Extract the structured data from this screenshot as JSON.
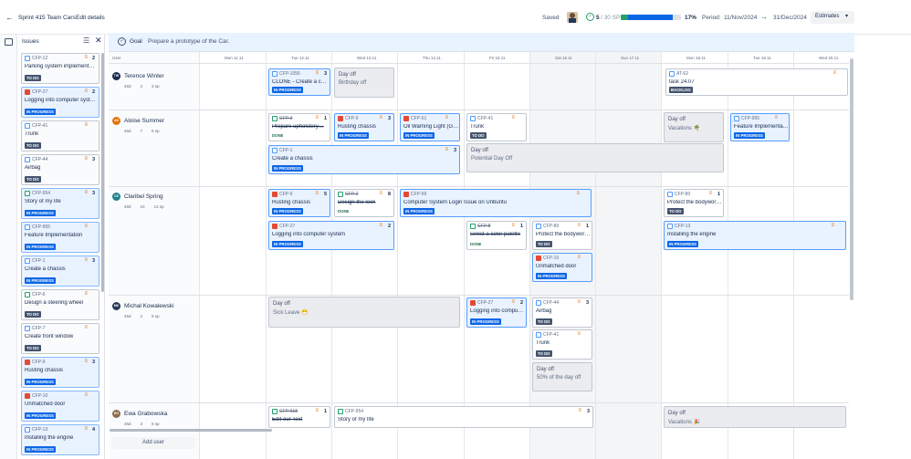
{
  "topbar": {
    "sprint": "Sprint 415 Team Cars",
    "edit": "Edit details",
    "saved": "Saved",
    "done_count": "5",
    "sp_total": "/ 30 SP",
    "progress_pct": "17%",
    "progress_value": 0.17,
    "period_label": "Period:",
    "start": "11/Nov/2024",
    "end": "31/Dec/2024",
    "estimates": "Estimates"
  },
  "goal": {
    "label": "Goal",
    "text": "Prepare a prototype of the Car."
  },
  "sidebar": {
    "title": "Issues",
    "items": [
      {
        "key": "CFP-12",
        "title": "Parking system implement…",
        "status": "TO DO",
        "est": "2",
        "type": "task"
      },
      {
        "key": "CFP-27",
        "title": "Logging into computer syst…",
        "status": "IN PROGRESS",
        "est": "2",
        "type": "bug"
      },
      {
        "key": "CFP-41",
        "title": "Trunk",
        "status": "TO DO",
        "est": "",
        "type": "task"
      },
      {
        "key": "CFP-44",
        "title": "Airbag",
        "status": "TO DO",
        "est": "3",
        "type": "task"
      },
      {
        "key": "CFP-954",
        "title": "Story of my life",
        "status": "IN PROGRESS",
        "est": "3",
        "type": "story"
      },
      {
        "key": "CFP-955",
        "title": "Feature Implementation",
        "status": "IN PROGRESS",
        "est": "",
        "type": "task"
      },
      {
        "key": "CFP-1",
        "title": "Create a chassis",
        "status": "IN PROGRESS",
        "est": "3",
        "type": "task"
      },
      {
        "key": "CFP-6",
        "title": "Design a steering wheel",
        "status": "TO DO",
        "est": "",
        "type": "story"
      },
      {
        "key": "CFP-7",
        "title": "Create front window",
        "status": "TO DO",
        "est": "",
        "type": "task"
      },
      {
        "key": "CFP-9",
        "title": "Rusting chassis",
        "status": "IN PROGRESS",
        "est": "3",
        "type": "bug"
      },
      {
        "key": "CFP-10",
        "title": "Unmatched door",
        "status": "IN PROGRESS",
        "est": "",
        "type": "bug"
      },
      {
        "key": "CFP-13",
        "title": "Installing the engine",
        "status": "IN PROGRESS",
        "est": "4",
        "type": "task"
      }
    ]
  },
  "grid": {
    "user_col": "User",
    "days": [
      "Mon 11.11",
      "Tue 12.11",
      "Wed 13.11",
      "Thu 14.11",
      "Fri 15.11",
      "Sat 16.11",
      "Sun 17.11",
      "Mon 18.11",
      "Tue 19.11",
      "Wed 20.11"
    ],
    "add_user": "Add user"
  },
  "users": [
    {
      "name": "Terence Winter",
      "initials": "TW",
      "color": "#172b4d",
      "hours": "46d",
      "tasks": "3",
      "sp": "3 sp"
    },
    {
      "name": "Aloise Summer",
      "initials": "AS",
      "color": "#e2740b",
      "hours": "46d",
      "tasks": "7",
      "sp": "8 sp"
    },
    {
      "name": "Claribel Spring",
      "initials": "CS",
      "color": "#1d7f8c",
      "hours": "49d",
      "tasks": "10",
      "sp": "13 sp"
    },
    {
      "name": "Michał Kowalewski",
      "initials": "MK",
      "color": "#253858",
      "hours": "45d",
      "tasks": "4",
      "sp": "5 sp"
    },
    {
      "name": "Ewa Grabowska",
      "initials": "EG",
      "color": "#8a6d4b",
      "hours": "45d",
      "tasks": "3",
      "sp": "6 sp"
    }
  ],
  "cards": [
    {
      "key": "CFP-1056",
      "title": "CLONE - Create a c…",
      "status": "IN PROGRESS",
      "est": "3",
      "type": "task",
      "strike": false
    },
    {
      "key": "AT-62",
      "title": "task 24.07",
      "status": "BACKLOG",
      "est": "",
      "type": "task",
      "strike": false
    },
    {
      "key": "CFP-3",
      "title": "Prepare upholstery…",
      "status": "DONE",
      "est": "1",
      "type": "story",
      "strike": true
    },
    {
      "key": "CFP-9",
      "title": "Rusting chassis",
      "status": "IN PROGRESS",
      "est": "3",
      "type": "bug",
      "strike": false
    },
    {
      "key": "CFP-51",
      "title": "Oil Warning Light (G…",
      "status": "IN PROGRESS",
      "est": "",
      "type": "bug",
      "strike": false
    },
    {
      "key": "CFP-41",
      "title": "Trunk",
      "status": "TO DO",
      "est": "",
      "type": "task",
      "strike": false
    },
    {
      "key": "CFP-955",
      "title": "Feature Implementa…",
      "status": "IN PROGRESS",
      "est": "",
      "type": "task",
      "strike": false
    },
    {
      "key": "CFP-1",
      "title": "Create a chassis",
      "status": "IN PROGRESS",
      "est": "3",
      "type": "task",
      "strike": false
    },
    {
      "key": "CFP-9",
      "title": "Rusting chassis",
      "status": "IN PROGRESS",
      "est": "5",
      "type": "bug",
      "strike": false
    },
    {
      "key": "CFP-2",
      "title": "Design the look",
      "status": "DONE",
      "est": "8",
      "type": "story",
      "strike": true
    },
    {
      "key": "CFP-59",
      "title": "Computer System Login Issue on Unbuntu",
      "status": "IN PROGRESS",
      "est": "",
      "type": "bug",
      "strike": false
    },
    {
      "key": "CFP-80",
      "title": "Protect the bodywor…",
      "status": "TO DO",
      "est": "1",
      "type": "task",
      "strike": false
    },
    {
      "key": "CFP-27",
      "title": "Logging into computer system",
      "status": "IN PROGRESS",
      "est": "2",
      "type": "bug",
      "strike": false
    },
    {
      "key": "CFP-8",
      "title": "select a color palette",
      "status": "DONE",
      "est": "1",
      "type": "story",
      "strike": true
    },
    {
      "key": "CFP-80",
      "title": "Protect the bodywor…",
      "status": "TO DO",
      "est": "1",
      "type": "task",
      "strike": false
    },
    {
      "key": "CFP-13",
      "title": "Installing the engine",
      "status": "IN PROGRESS",
      "est": "",
      "type": "task",
      "strike": false
    },
    {
      "key": "CFP-10",
      "title": "Unmatched door",
      "status": "IN PROGRESS",
      "est": "",
      "type": "bug",
      "strike": false
    },
    {
      "key": "CFP-27",
      "title": "Logging into compu…",
      "status": "IN PROGRESS",
      "est": "2",
      "type": "bug",
      "strike": false
    },
    {
      "key": "CFP-44",
      "title": "Airbag",
      "status": "TO DO",
      "est": "3",
      "type": "task",
      "strike": false
    },
    {
      "key": "CFP-41",
      "title": "Trunk",
      "status": "TO DO",
      "est": "",
      "type": "task",
      "strike": false
    },
    {
      "key": "CFP-918",
      "title": "Edit our Text",
      "status": "",
      "est": "1",
      "type": "story",
      "strike": true
    },
    {
      "key": "CFP-954",
      "title": "Story of my life",
      "status": "",
      "est": "3",
      "type": "story",
      "strike": false
    }
  ],
  "dayoffs": [
    {
      "title": "Day off",
      "sub": "Birthday off"
    },
    {
      "title": "Day off",
      "sub": "Vacations 🌴"
    },
    {
      "title": "Day off",
      "sub": "Potential Day Off"
    },
    {
      "title": "Day off",
      "sub": "Sick Leave 😷"
    },
    {
      "title": "Day off",
      "sub": "50% of the day off"
    },
    {
      "title": "Day off",
      "sub": "Vacations 🎉"
    }
  ]
}
